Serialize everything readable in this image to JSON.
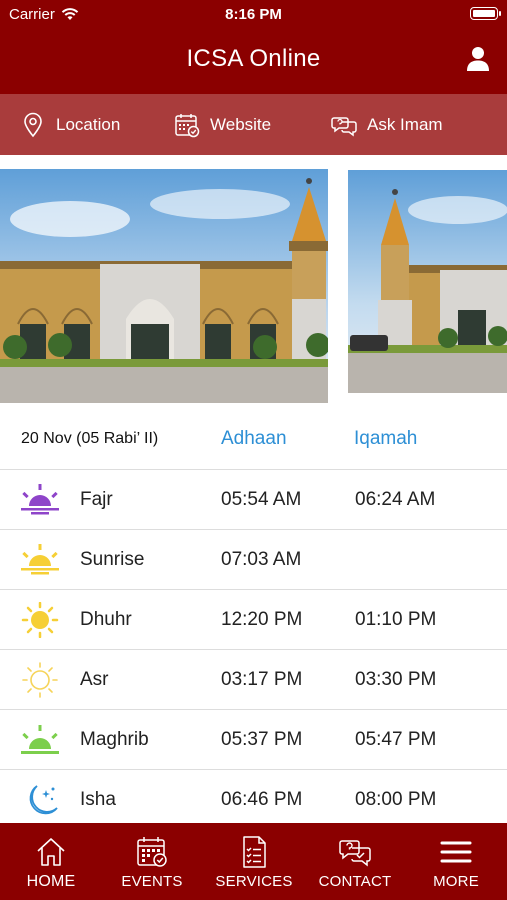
{
  "status_bar": {
    "carrier": "Carrier",
    "time": "8:16 PM"
  },
  "header": {
    "title": "ICSA Online",
    "profile_icon": "user-icon"
  },
  "quick_links": [
    {
      "label": "Location",
      "icon": "map-pin-icon"
    },
    {
      "label": "Website",
      "icon": "calendar-web-icon"
    },
    {
      "label": "Ask Imam",
      "icon": "chat-question-icon"
    }
  ],
  "prayer_table": {
    "date": "20 Nov (05 Rabi’ II)",
    "col_adhaan": "Adhaan",
    "col_iqamah": "Iqamah",
    "rows": [
      {
        "name": "Fajr",
        "adhaan": "05:54 AM",
        "iqamah": "06:24 AM",
        "icon": "sunrise-purple-icon",
        "color": "#8e44c9"
      },
      {
        "name": "Sunrise",
        "adhaan": "07:03 AM",
        "iqamah": "",
        "icon": "sunrise-yellow-icon",
        "color": "#f6cf35"
      },
      {
        "name": "Dhuhr",
        "adhaan": "12:20 PM",
        "iqamah": "01:10 PM",
        "icon": "sun-icon",
        "color": "#f6cf35"
      },
      {
        "name": "Asr",
        "adhaan": "03:17 PM",
        "iqamah": "03:30 PM",
        "icon": "sun-outline-icon",
        "color": "#f6cf35"
      },
      {
        "name": "Maghrib",
        "adhaan": "05:37 PM",
        "iqamah": "05:47 PM",
        "icon": "sunset-green-icon",
        "color": "#7ccf4c"
      },
      {
        "name": "Isha",
        "adhaan": "06:46 PM",
        "iqamah": "08:00 PM",
        "icon": "moon-stars-icon",
        "color": "#2d8fd5"
      }
    ]
  },
  "tabs": [
    {
      "label": "HOME",
      "icon": "home-icon"
    },
    {
      "label": "EVENTS",
      "icon": "calendar-icon"
    },
    {
      "label": "SERVICES",
      "icon": "document-icon"
    },
    {
      "label": "CONTACT",
      "icon": "chat-icon"
    },
    {
      "label": "MORE",
      "icon": "menu-icon"
    }
  ],
  "colors": {
    "brand": "#8b0000",
    "quickbar": "#a93c3c",
    "accent": "#2d8fd5"
  }
}
